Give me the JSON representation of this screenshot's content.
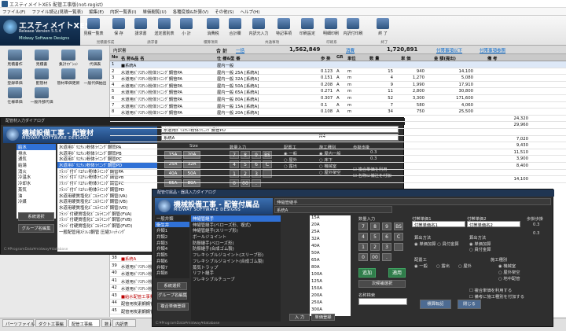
{
  "window": {
    "title": "エスティメイトXE5 配管工事版(not-regist)"
  },
  "menu": [
    "ファイル(F)",
    "ファイル読込(見積一覧表)",
    "編集(E)",
    "内訳一覧表(I)",
    "単価閲覧(U)",
    "各種変換&計算(V)",
    "その他(S)",
    "ヘルプ(H)"
  ],
  "logo": {
    "name": "エスティメイトXE5",
    "version": "Release Version 5.5.4",
    "company": "Midway Software Designs"
  },
  "ribbon": {
    "buttons": [
      "見積一覧表",
      "保 存",
      "請求書",
      "送定書別表",
      "小 計",
      "消費税",
      "合計欄",
      "内訳元入力",
      "特記事項",
      "印刷設定",
      "明細印刷",
      "内訳付印刷",
      "終 了"
    ],
    "groups": [
      "見積書作成",
      "請求書",
      "積算項目",
      "共通事項",
      "印刷系",
      "終了"
    ]
  },
  "left_panel": {
    "buttons": [
      "見積書作",
      "見積書",
      "集計ｵﾌﾟｼｮﾝ",
      "代価表",
      "登録単価",
      "配管材",
      "管材単価更新",
      "一般代価抽出",
      "仕様単価",
      "一般外部代価"
    ],
    "sub_labels": [
      "見積作成",
      "単価作成"
    ]
  },
  "summary": {
    "label": "内訳書",
    "total_label": "合 計",
    "total_link": "一括",
    "total_value": "1,562,849",
    "tax_label": "消費",
    "tax_value": "1,720,891",
    "link1": "付帯事項以下",
    "link2": "付帯事項参照"
  },
  "table": {
    "headers": [
      "No",
      "名 称&品 名",
      "仕 様&型 番",
      "歩 掛",
      "GR",
      "単位",
      "数 量",
      "単 価",
      "金 額(提出)",
      "備 考"
    ],
    "rows": [
      {
        "no": "1",
        "name": "■系統A",
        "spec": "屋内一般",
        "k": "",
        "gr": "",
        "unit": "",
        "qty": "",
        "price": "",
        "amount": "",
        "note": ""
      },
      {
        "no": "2",
        "name": "水道用ﾎﾞﾘｴﾁﾚﾝ粉体ﾗｲﾆﾝｸﾞ鋼管PA",
        "spec": "屋内一般 25A [系統A]",
        "k": "0.123",
        "gr": "A",
        "unit": "m",
        "qty": "15",
        "price": "940",
        "amount": "14,100",
        "note": ""
      },
      {
        "no": "3",
        "name": "水道用ﾎﾞﾘｴﾁﾚﾝ粉体ﾗｲﾆﾝｸﾞ鋼管PA",
        "spec": "屋内一般 32A [系統A]",
        "k": "0.151",
        "gr": "A",
        "unit": "m",
        "qty": "4",
        "price": "1,270",
        "amount": "5,080",
        "note": ""
      },
      {
        "no": "4",
        "name": "水道用ﾎﾞﾘｴﾁﾚﾝ粉体ﾗｲﾆﾝｸﾞ鋼管PA",
        "spec": "屋内一般 50A [系統A]",
        "k": "0.208",
        "gr": "A",
        "unit": "m",
        "qty": "9",
        "price": "1,990",
        "amount": "17,910",
        "note": ""
      },
      {
        "no": "5",
        "name": "水道用ﾎﾞﾘｴﾁﾚﾝ粉体ﾗｲﾆﾝｸﾞ鋼管PA",
        "spec": "屋内一般 65A [系統A]",
        "k": "0.271",
        "gr": "A",
        "unit": "m",
        "qty": "11",
        "price": "2,800",
        "amount": "30,800",
        "note": ""
      },
      {
        "no": "6",
        "name": "水道用ﾎﾞﾘｴﾁﾚﾝ粉体ﾗｲﾆﾝｸﾞ鋼管PA",
        "spec": "屋内一般 80A [系統A]",
        "k": "0.307",
        "gr": "A",
        "unit": "m",
        "qty": "52",
        "price": "3,300",
        "amount": "171,600",
        "note": ""
      },
      {
        "no": "7",
        "name": "水道用ﾎﾞﾘｴﾁﾚﾝ粉体ﾗｲﾆﾝｸﾞ鋼管PA",
        "spec": "屋内一般 15A [系統A]",
        "k": "0.1",
        "gr": "A",
        "unit": "m",
        "qty": "7",
        "price": "580",
        "amount": "4,060",
        "note": ""
      },
      {
        "no": "8",
        "name": "水道用ﾎﾞﾘｴﾁﾚﾝ粉体ﾗｲﾆﾝｸﾞ鋼管PA",
        "spec": "屋内一般 20A [系統A]",
        "k": "0.108",
        "gr": "A",
        "unit": "m",
        "qty": "34",
        "price": "750",
        "amount": "25,500",
        "note": ""
      }
    ],
    "amount_column": [
      "24,320",
      "29,960",
      "",
      "7,020",
      "9,430",
      "11,510",
      "3,900",
      "8,400",
      "",
      "14,100"
    ],
    "bottom_rows": [
      {
        "no": "38",
        "name": "■系統A"
      },
      {
        "no": "39",
        "name": "水道用ﾎﾞﾘｴﾁﾚﾝ粉体ﾗｲﾆﾝｸﾞ鋼管PD"
      },
      {
        "no": "40",
        "name": "水道用ﾎﾞﾘｴﾁﾚﾝ粉体ﾗｲﾆﾝｸﾞ鋼管PD"
      },
      {
        "no": "41",
        "name": "水道用ﾎﾞﾘｴﾁﾚﾝ粉体ﾗｲﾆﾝｸﾞ鋼管PD"
      },
      {
        "no": "42",
        "name": "水道用ﾎﾞﾘｴﾁﾚﾝ粉体ﾗｲﾆﾝｸﾞ鋼管PD"
      },
      {
        "no": "43",
        "name": "■給水配管工事費"
      },
      {
        "no": "44",
        "name": "配管用炭素鋼鋼管"
      },
      {
        "no": "45",
        "name": "配管用炭素鋼鋼管"
      }
    ]
  },
  "dialog1": {
    "header": "配管材入力ダイアログ",
    "banner_title": "機械設備工事 - 配管材",
    "banner_sub": "MIDWAY SOFTWARE DESIGNS",
    "categories": [
      "給水",
      "排水",
      "通気",
      "給湯",
      "消火",
      "冷温水",
      "冷却水",
      "蒸気",
      "油",
      "冷媒"
    ],
    "items": [
      "水道用ﾎﾞﾘｴﾁﾚﾝ粉体ﾗｲﾆﾝｸﾞ鋼管PA",
      "水道用ﾎﾞﾘｴﾁﾚﾝ粉体ﾗｲﾆﾝｸﾞ鋼管PB",
      "水道用ﾎﾞﾘｴﾁﾚﾝ粉体ﾗｲﾆﾝｸﾞ鋼管PC",
      "水道用ﾎﾞﾘｴﾁﾚﾝ粉体ﾗｲﾆﾝｸﾞ鋼管PD",
      "ﾌﾗﾝｼﾞ付ﾎﾞﾘｴﾁﾚﾝ粉体ﾗｲﾆﾝｸﾞ鋼管PA",
      "ﾌﾗﾝｼﾞ付ﾎﾞﾘｴﾁﾚﾝ粉体ﾗｲﾆﾝｸﾞ鋼管PB",
      "ﾌﾗﾝｼﾞ付ﾎﾞﾘｴﾁﾚﾝ粉体ﾗｲﾆﾝｸﾞ鋼管PC",
      "ﾌﾗﾝｼﾞ付ﾎﾞﾘｴﾁﾚﾝ粉体ﾗｲﾆﾝｸﾞ鋼管PD",
      "水道用硬質塩化ﾋﾞﾆﾙﾗｲﾆﾝｸﾞ鋼管(VA)",
      "水道用硬質塩化ﾋﾞﾆﾙﾗｲﾆﾝｸﾞ鋼管(VB)",
      "水道用硬質塩化ﾋﾞﾆﾙﾗｲﾆﾝｸﾞ鋼管(VD)",
      "ﾌﾗﾝｼﾞ付硬質塩化ﾋﾞﾆﾙﾗｲﾆﾝｸﾞ鋼管(FVA)",
      "ﾌﾗﾝｼﾞ付硬質塩化ﾋﾞﾆﾙﾗｲﾆﾝｸﾞ鋼管(FVB)",
      "ﾌﾗﾝｼﾞ付硬質塩化ﾋﾞﾆﾙﾗｲﾆﾝｸﾞ鋼管(FVD)",
      "一般配管用ｽﾃﾝﾚｽ鋼管 圧縮ﾌｨｯﾃｨﾝｸﾞ"
    ],
    "selected_item": "水道用ﾎﾞﾘｴﾁﾚﾝ粉体ﾗｲﾆﾝｸﾞ鋼管PD",
    "system_label": "系統A",
    "spec": "M4",
    "size_label": "Size",
    "sizes": [
      "15A",
      "20A",
      "25A",
      "32A",
      "40A",
      "50A",
      "65A",
      "80A",
      "100A",
      "125A",
      "150A"
    ],
    "qty_label": "数量入力",
    "nums": [
      "7",
      "8",
      "9",
      "BS",
      "4",
      "5",
      "6",
      "C",
      "1",
      "2",
      "3",
      "",
      "0",
      "00",
      "."
    ],
    "place_label": "配置工",
    "place_opts": [
      "一般",
      "屋外",
      "露出"
    ],
    "pipe_label": "施工種別",
    "pipe_opts": [
      "屋内一般",
      "床下",
      "機械室",
      "屋外架空"
    ],
    "coef_label": "歩掛歩掛",
    "coef_vals": [
      "0.3",
      "0.3"
    ],
    "checks": [
      "複合単価を利用",
      "名称に補注を付加"
    ],
    "btn_select": "系統選択",
    "btn_group": "グループ名編集",
    "path": "C:¥ProgramData¥midway¥database"
  },
  "dialog2": {
    "header": "配管付属品・器具入力ダイアログ",
    "banner_title": "機械設備工事 - 配管付属品",
    "banner_sub": "MIDWAY SOFTWARE DESIGNS",
    "title_field": "伸縮管継手",
    "categories": [
      "一般弁類",
      "衛生弁",
      "弁類1",
      "弁類2",
      "弁類3",
      "弁類4",
      "弁類5",
      "弁類6",
      "弁類7",
      "弁類8"
    ],
    "items": [
      "伸縮管継手",
      "伸縮管継手(ベローズ形、複式)",
      "伸縮管継手(スリーブ形)",
      "ボールジョイント",
      "防振継手(ベローズ形)",
      "防振継手(合成ゴム製)",
      "フレキシブルジョイント(スリーブ形)",
      "フレキシブルジョイント(合成ゴム製)",
      "蒸気トラップ",
      "リフト継手",
      "フレキシブルチューブ"
    ],
    "system_label": "系統A",
    "sizes": [
      "15A",
      "20A",
      "25A",
      "32A",
      "40A",
      "50A",
      "65A",
      "80A",
      "100A",
      "125A",
      "150A",
      "200A",
      "250A",
      "300A"
    ],
    "qty_label": "数量入力",
    "nums": [
      "7",
      "8",
      "9",
      "BS",
      "4",
      "5",
      "6",
      "C",
      "1",
      "2",
      "3",
      "",
      "0",
      "00",
      "."
    ],
    "btn_add": "追加",
    "btn_apply": "適用",
    "btn_next": "次候補選択",
    "search_label": "名称検索",
    "tab_in": "入 力",
    "tab_reg": "単価登録",
    "unit_a_label": "付帯単価1",
    "unit_b_label": "付帯単価2",
    "unit_a_field": "付帯単価名1",
    "unit_b_field": "付帯単価名2",
    "calc_label": "算出方法",
    "calc_opts": [
      "単価加算",
      "員付金算"
    ],
    "calc2_opts": [
      "単価加算",
      "員付金算"
    ],
    "coef_label": "歩掛歩掛",
    "coef_vals": [
      "0.3",
      "0.3"
    ],
    "place_label": "配置工",
    "place_opts": [
      "一般",
      "露出",
      "屋外"
    ],
    "pipe_label": "施工種別",
    "pipe_opts": [
      "機械室",
      "屋外架空",
      "地中配管"
    ],
    "checks": [
      "複合単価を利用する",
      "備考に施工種別を付加する"
    ],
    "btn_calc": "積算転記",
    "btn_close": "閉じる",
    "btn_sys": "系統選択",
    "btn_group": "グループ名編集",
    "btn_reg": "複合単価登録",
    "path": "C:¥ProgramData¥midway¥database"
  },
  "bottom_tabs": [
    "パーツファイル",
    "ダクト工事編",
    "配管工事編",
    "数↓",
    "内訳表"
  ],
  "colors": {
    "accent": "#3071d6",
    "dialog_bg": "#2f2f2f",
    "banner": "#2a5a96"
  }
}
